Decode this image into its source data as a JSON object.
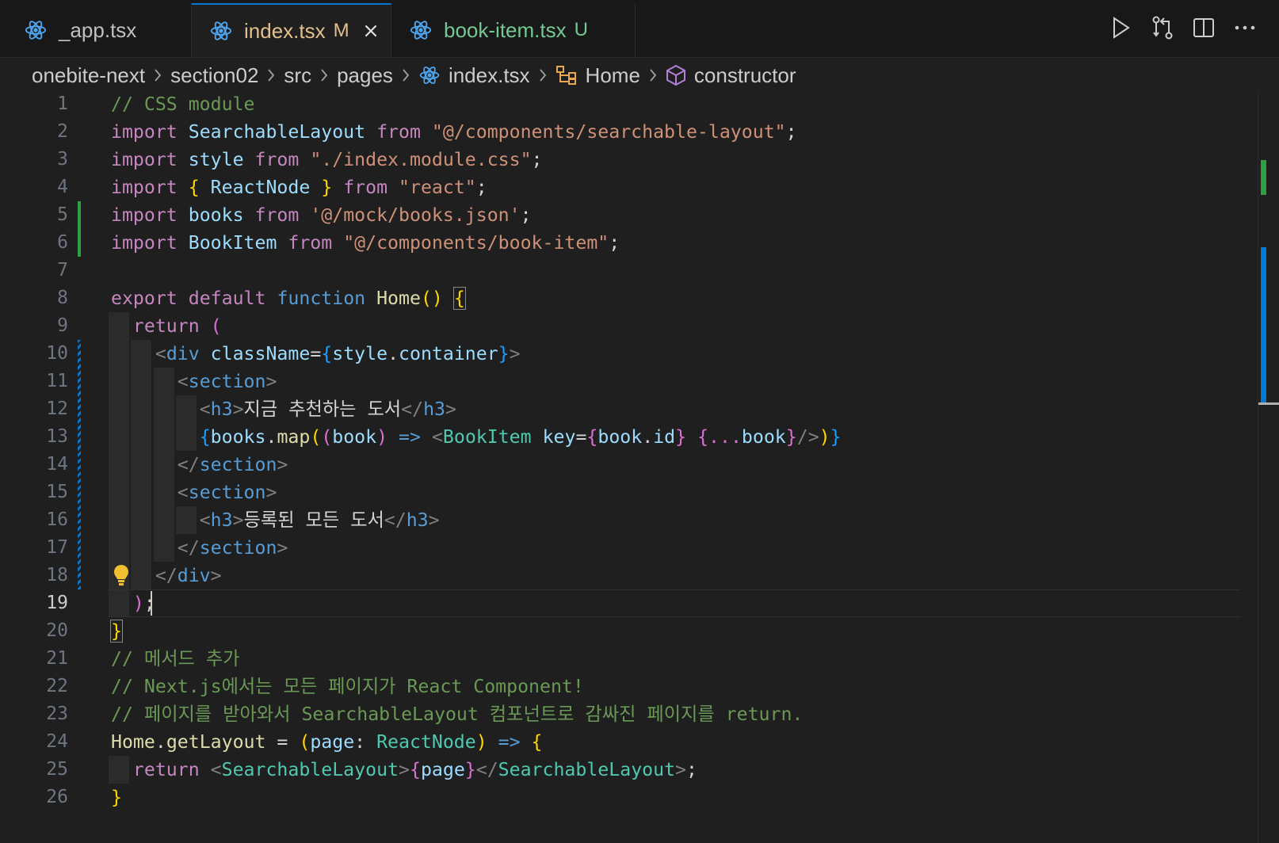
{
  "tabs": [
    {
      "label": "_app.tsx",
      "badge": ""
    },
    {
      "label": "index.tsx",
      "badge": "M"
    },
    {
      "label": "book-item.tsx",
      "badge": "U"
    }
  ],
  "breadcrumbs": {
    "project": "onebite-next",
    "folder1": "section02",
    "folder2": "src",
    "folder3": "pages",
    "file": "index.tsx",
    "symbol": "Home",
    "member": "constructor"
  },
  "editor": {
    "line_numbers": [
      "1",
      "2",
      "3",
      "4",
      "5",
      "6",
      "7",
      "8",
      "9",
      "10",
      "11",
      "12",
      "13",
      "14",
      "15",
      "16",
      "17",
      "18",
      "19",
      "20",
      "21",
      "22",
      "23",
      "24",
      "25",
      "26"
    ],
    "current_line": "19",
    "lines": {
      "l1": "// CSS module",
      "l2_import": "import",
      "l2_name": "SearchableLayout",
      "l2_from": "from",
      "l2_str": "\"@/components/searchable-layout\"",
      "l2_end": ";",
      "l3_import": "import",
      "l3_name": "style",
      "l3_from": "from",
      "l3_str": "\"./index.module.css\"",
      "l3_end": ";",
      "l4_import": "import",
      "l4_open": "{",
      "l4_name": "ReactNode",
      "l4_close": "}",
      "l4_from": "from",
      "l4_str": "\"react\"",
      "l4_end": ";",
      "l5_import": "import",
      "l5_name": "books",
      "l5_from": "from",
      "l5_str": "'@/mock/books.json'",
      "l5_end": ";",
      "l6_import": "import",
      "l6_name": "BookItem",
      "l6_from": "from",
      "l6_str": "\"@/components/book-item\"",
      "l6_end": ";",
      "l8_export": "export",
      "l8_default": "default",
      "l8_function": "function",
      "l8_name": "Home",
      "l8_parens": "()",
      "l8_brace": "{",
      "l9_return": "return",
      "l9_paren": "(",
      "l10_lt": "<",
      "l10_tag": "div",
      "l10_attr": "className",
      "l10_eq": "=",
      "l10_ob": "{",
      "l10_obj": "style",
      "l10_dot": ".",
      "l10_prop": "container",
      "l10_cb": "}",
      "l10_gt": ">",
      "l11_lt": "<",
      "l11_tag": "section",
      "l11_gt": ">",
      "l12_lt": "<",
      "l12_tag": "h3",
      "l12_gt": ">",
      "l12_text": "지금 추천하는 도서",
      "l12_clt": "</",
      "l12_ctag": "h3",
      "l12_cgt": ">",
      "l13_ob": "{",
      "l13_obj": "books",
      "l13_dot": ".",
      "l13_fn": "map",
      "l13_p1": "(",
      "l13_p2": "(",
      "l13_arg": "book",
      "l13_p3": ")",
      "l13_arrow": "=>",
      "l13_lt": "<",
      "l13_comp": "BookItem",
      "l13_attr": "key",
      "l13_eq": "=",
      "l13_kob": "{",
      "l13_kobj": "book",
      "l13_kdot": ".",
      "l13_kprop": "id",
      "l13_kcb": "}",
      "l13_sob": "{",
      "l13_spread": "...",
      "l13_sobj": "book",
      "l13_scb": "}",
      "l13_self": "/>",
      "l13_p4": ")",
      "l13_cb": "}",
      "l14_lt": "</",
      "l14_tag": "section",
      "l14_gt": ">",
      "l15_lt": "<",
      "l15_tag": "section",
      "l15_gt": ">",
      "l16_lt": "<",
      "l16_tag": "h3",
      "l16_gt": ">",
      "l16_text": "등록된 모든 도서",
      "l16_clt": "</",
      "l16_ctag": "h3",
      "l16_cgt": ">",
      "l17_lt": "</",
      "l17_tag": "section",
      "l17_gt": ">",
      "l18_lt": "</",
      "l18_tag": "div",
      "l18_gt": ">",
      "l19_paren": ")",
      "l19_semi": ";",
      "l20_brace": "}",
      "l21": "// 메서드 추가",
      "l22": "// Next.js에서는 모든 페이지가 React Component!",
      "l23": "// 페이지를 받아와서 SearchableLayout 컴포넌트로 감싸진 페이지를 return.",
      "l24_obj": "Home",
      "l24_dot": ".",
      "l24_fn": "getLayout",
      "l24_eq": " = ",
      "l24_po": "(",
      "l24_arg": "page",
      "l24_colon": ": ",
      "l24_type": "ReactNode",
      "l24_pc": ")",
      "l24_arrow": "=>",
      "l24_brace": "{",
      "l25_return": "return",
      "l25_lt": "<",
      "l25_comp": "SearchableLayout",
      "l25_gt": ">",
      "l25_ob": "{",
      "l25_var": "page",
      "l25_cb": "}",
      "l25_clt": "</",
      "l25_ccomp": "SearchableLayout",
      "l25_cgt": ">",
      "l25_semi": ";",
      "l26_brace": "}"
    }
  },
  "colors": {
    "editor_bg": "#1f1f1f",
    "tabbar_bg": "#181818",
    "active_tab_accent": "#0078d4",
    "modified": "#e2c08d",
    "untracked": "#73c991",
    "added_gutter": "#2ea043",
    "modified_gutter": "#0078d4"
  },
  "icons": [
    "react-icon",
    "close-icon",
    "run-icon",
    "compare-changes-icon",
    "split-editor-icon",
    "more-actions-icon",
    "symbol-method-icon",
    "symbol-cube-icon",
    "lightbulb-icon"
  ]
}
